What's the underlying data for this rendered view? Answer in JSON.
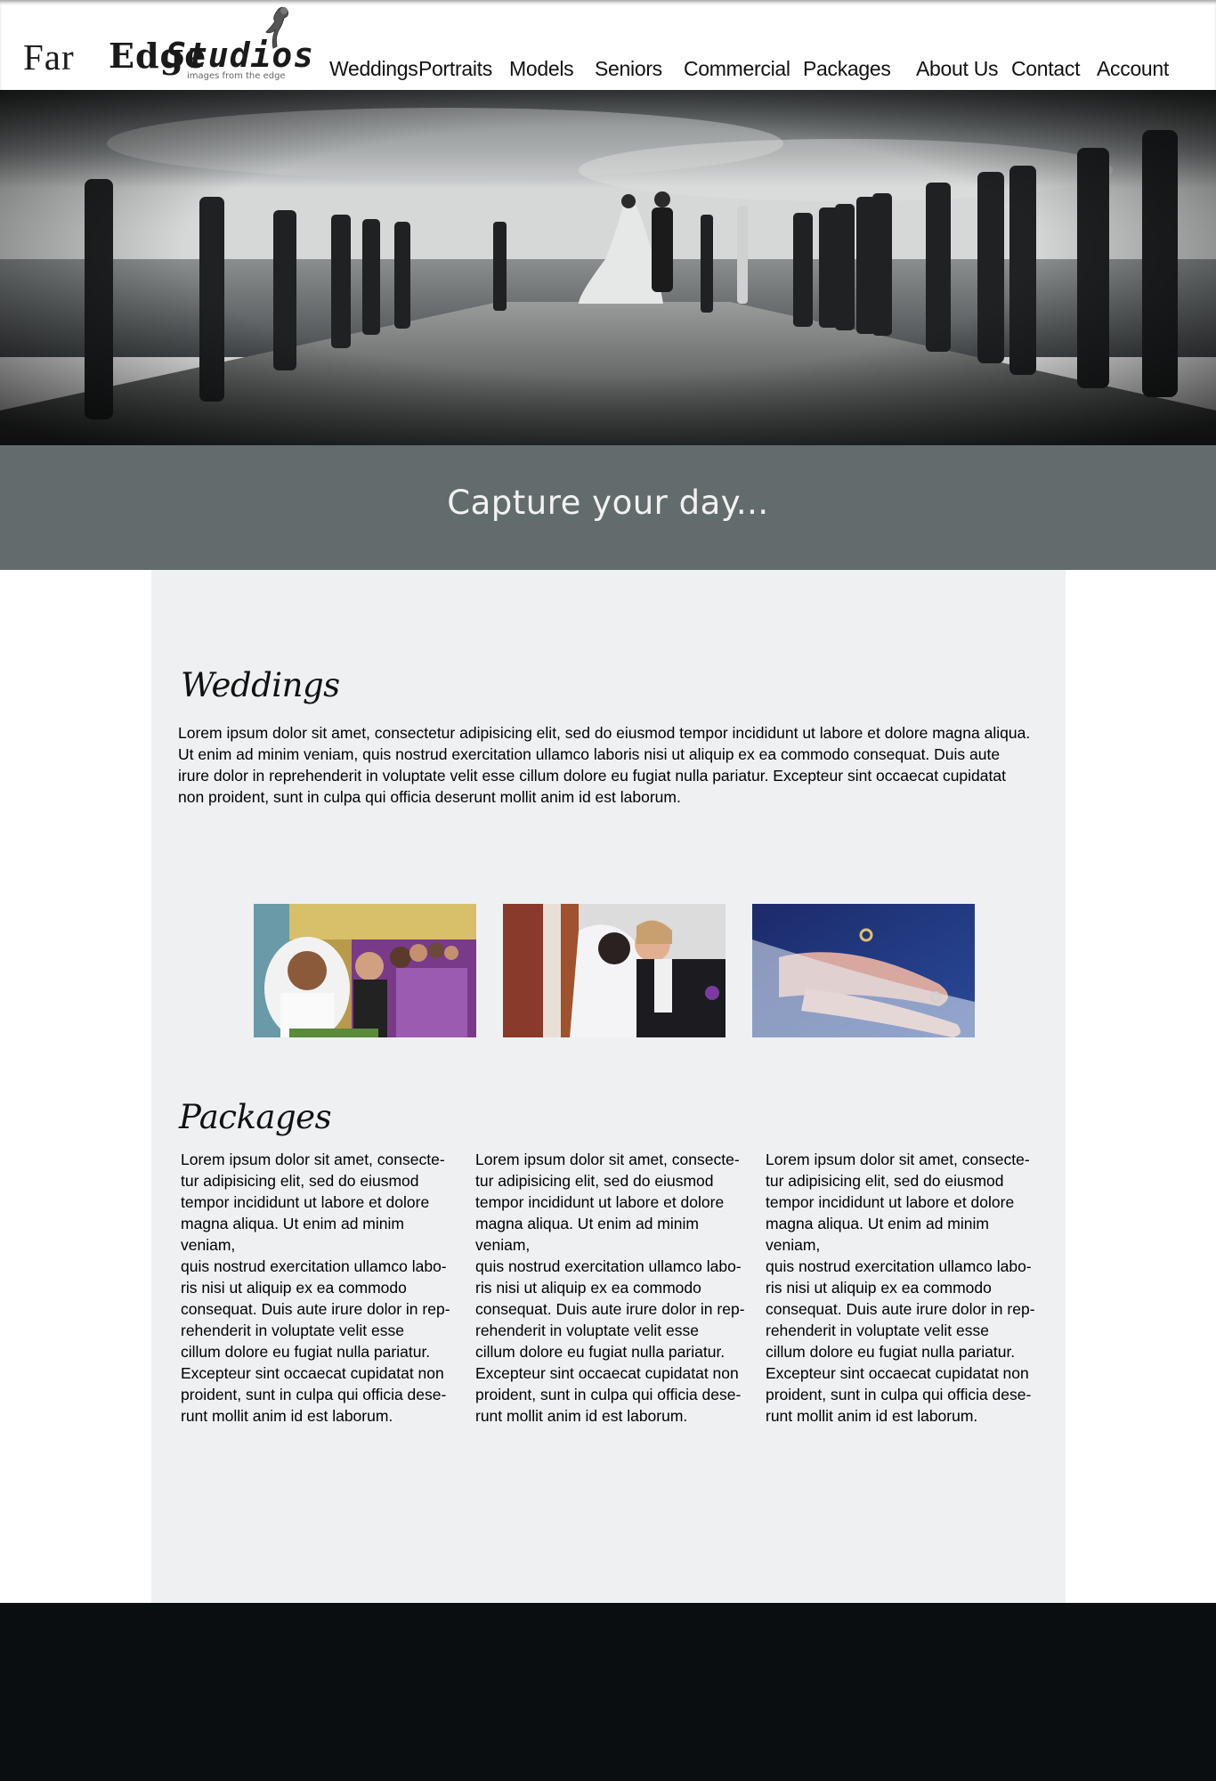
{
  "brand": {
    "word1": "Far",
    "word2": "Edge",
    "word3": "Studios",
    "tagline": "images from the edge"
  },
  "nav": [
    {
      "label": "Weddings"
    },
    {
      "label": "Portraits"
    },
    {
      "label": "Models"
    },
    {
      "label": "Seniors"
    },
    {
      "label": "Commercial"
    },
    {
      "label": "Packages"
    },
    {
      "label": "About Us"
    },
    {
      "label": "Contact"
    },
    {
      "label": "Account"
    }
  ],
  "hero": {
    "tagline": "Capture your day..."
  },
  "weddings": {
    "heading": "Weddings",
    "body": "Lorem ipsum dolor sit amet, consectetur adipisicing elit, sed do eiusmod tempor incididunt ut labore et dolore magna aliqua. Ut enim ad minim veniam, quis nostrud exercitation ullamco laboris nisi ut aliquip ex ea commodo consequat. Duis aute irure dolor in reprehenderit in voluptate velit esse cillum dolore eu fugiat nulla pariatur. Excepteur sint occaecat cupidatat non proident, sunt in culpa qui officia deserunt mollit anim id est laborum."
  },
  "packages": {
    "heading": "Packages",
    "columns": [
      {
        "text": "Lorem ipsum dolor sit amet, consecte-\ntur adipisicing elit, sed do eiusmod\ntempor incididunt ut labore et dolore\nmagna aliqua. Ut enim ad minim\nveniam,\nquis nostrud exercitation ullamco labo-\nris nisi ut aliquip ex ea commodo\nconsequat. Duis aute irure dolor in rep-\nrehenderit in voluptate velit esse\ncillum dolore eu fugiat nulla pariatur.\nExcepteur sint occaecat cupidatat non\nproident, sunt in culpa qui officia dese-\nrunt mollit anim id est laborum."
      },
      {
        "text": "Lorem ipsum dolor sit amet, consecte-\ntur adipisicing elit, sed do eiusmod\ntempor incididunt ut labore et dolore\nmagna aliqua. Ut enim ad minim\nveniam,\nquis nostrud exercitation ullamco labo-\nris nisi ut aliquip ex ea commodo\nconsequat. Duis aute irure dolor in rep-\nrehenderit in voluptate velit esse\ncillum dolore eu fugiat nulla pariatur.\nExcepteur sint occaecat cupidatat non\nproident, sunt in culpa qui officia dese-\nrunt mollit anim id est laborum."
      },
      {
        "text": "Lorem ipsum dolor sit amet, consecte-\ntur adipisicing elit, sed do eiusmod\ntempor incididunt ut labore et dolore\nmagna aliqua. Ut enim ad minim\nveniam,\nquis nostrud exercitation ullamco labo-\nris nisi ut aliquip ex ea commodo\nconsequat. Duis aute irure dolor in rep-\nrehenderit in voluptate velit esse\ncillum dolore eu fugiat nulla pariatur.\nExcepteur sint occaecat cupidatat non\nproident, sunt in culpa qui officia dese-\nrunt mollit anim id est laborum."
      }
    ]
  },
  "colors": {
    "tagline_band": "#636c6c",
    "panel": "#eff0f2",
    "footer": "#0b0e10"
  }
}
